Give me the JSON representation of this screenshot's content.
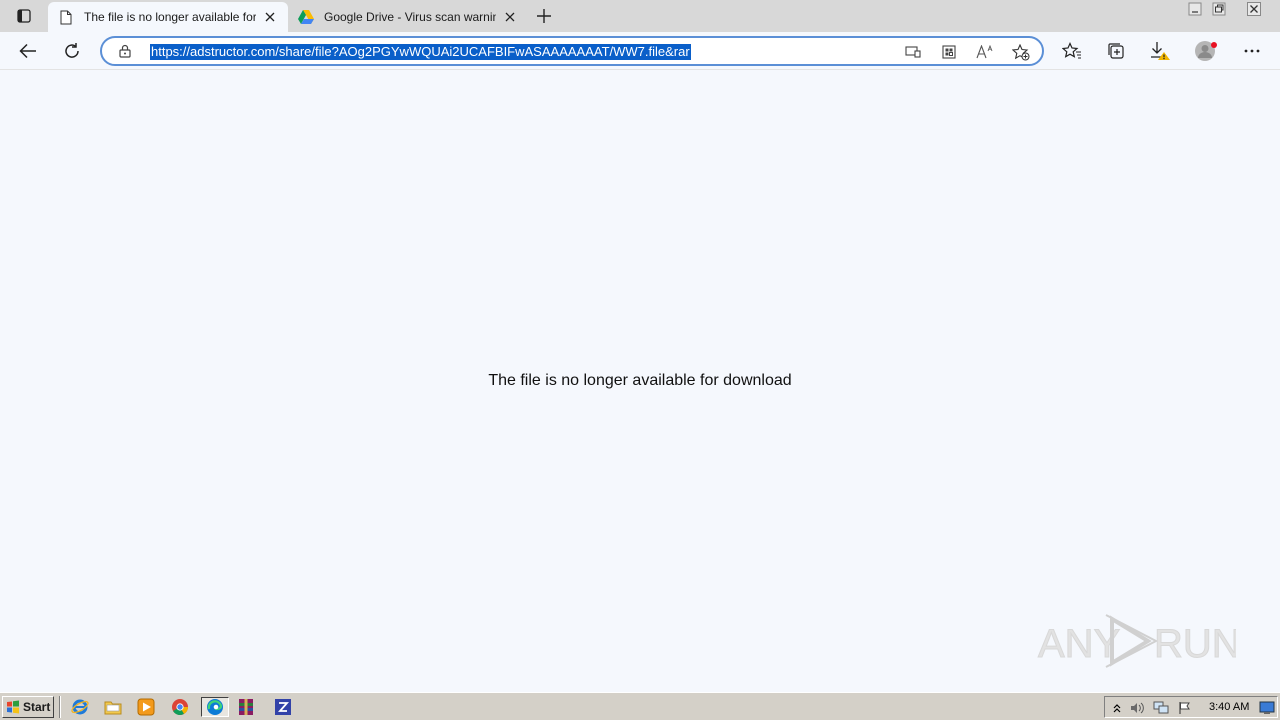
{
  "tabs": [
    {
      "title": "The file is no longer available for",
      "icon": "document-icon",
      "active": true
    },
    {
      "title": "Google Drive - Virus scan warning",
      "icon": "google-drive-icon",
      "active": false
    }
  ],
  "address_bar": {
    "url": "https://adstructor.com/share/file?AOg2PGYwWQUAi2UCAFBIFwASAAAAAAAT/WW7.file&rar"
  },
  "page": {
    "message": "The file is no longer available for download"
  },
  "watermark": {
    "text": "ANY RUN"
  },
  "taskbar": {
    "start_label": "Start",
    "clock": "3:40 AM",
    "quick_launch": [
      "ie-icon",
      "folder-icon",
      "media-player-icon",
      "chrome-icon",
      "edge-icon",
      "winrar-icon",
      "app-icon"
    ]
  },
  "colors": {
    "accent": "#0a5fc9",
    "content_bg": "#f5f8fd",
    "taskbar_bg": "#d4d0c8",
    "download_warning": "#f2b600"
  }
}
